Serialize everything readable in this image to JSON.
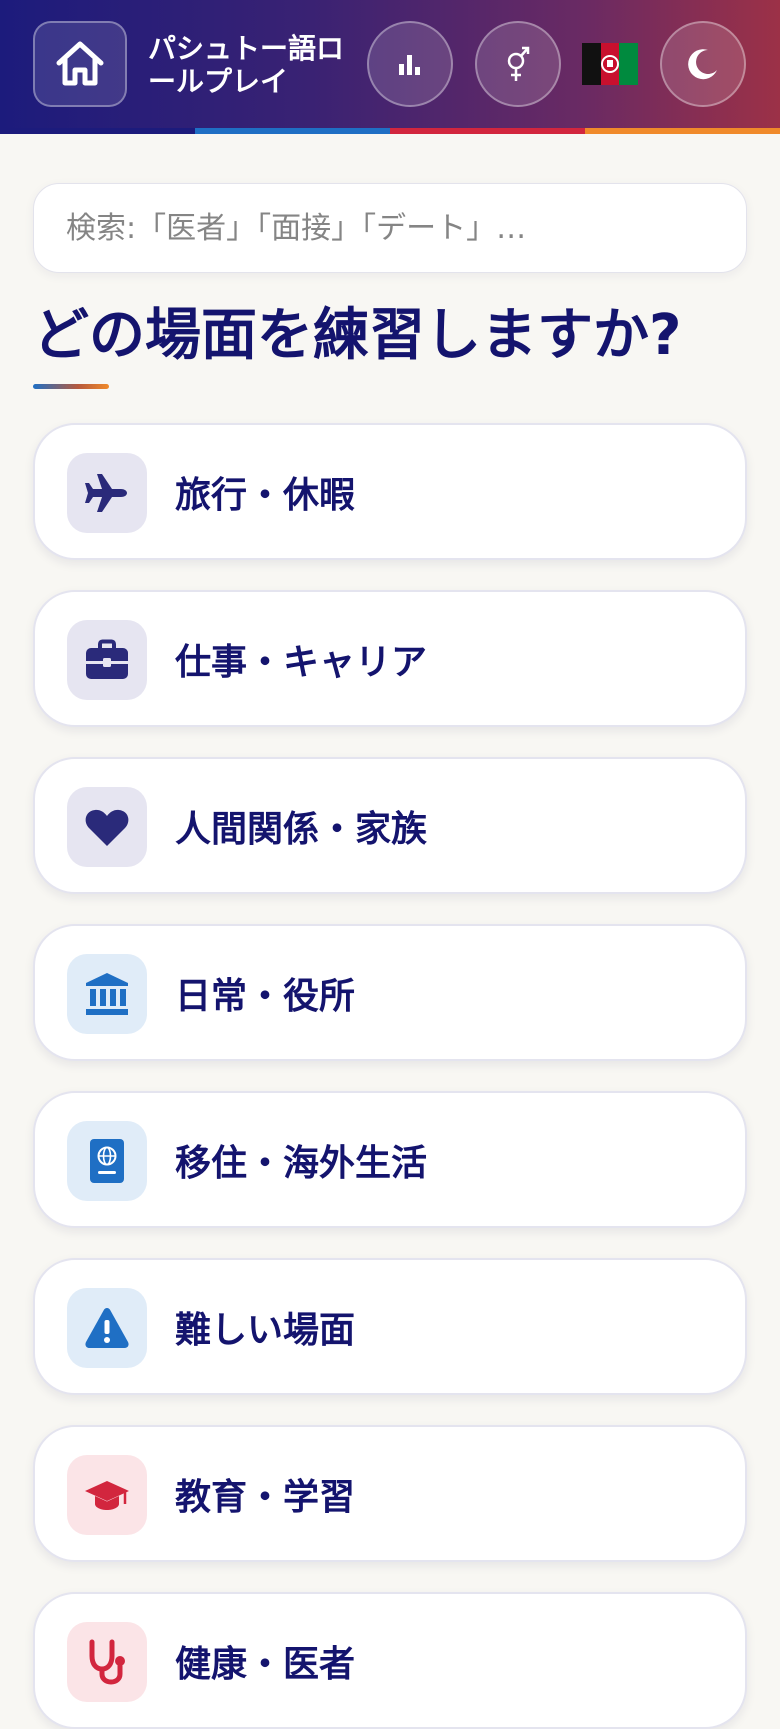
{
  "header": {
    "title": "パシュトー語ロールプレイ",
    "title_line1": "パシュトー語ロ",
    "title_line2": "ールプレイ",
    "stripe_colors": [
      "#1c1b7c",
      "#1f6fc4",
      "#d2263e",
      "#f08a2a"
    ],
    "buttons": {
      "home_icon": "home-icon",
      "stats_icon": "bar-chart-icon",
      "gender_icon": "gender-symbol-icon",
      "flag": "🇦🇫",
      "theme_icon": "moon-icon"
    }
  },
  "search": {
    "placeholder": "検索:「医者」「面接」「デート」…",
    "value": ""
  },
  "heading": "どの場面を練習しますか?",
  "categories": [
    {
      "label": "旅行・休暇",
      "icon": "airplane-icon",
      "color": "#2a2a7a",
      "bg": "#e6e5f1"
    },
    {
      "label": "仕事・キャリア",
      "icon": "briefcase-icon",
      "color": "#2a2a7a",
      "bg": "#e6e5f1"
    },
    {
      "label": "人間関係・家族",
      "icon": "heart-icon",
      "color": "#2a2a7a",
      "bg": "#e6e5f1"
    },
    {
      "label": "日常・役所",
      "icon": "bank-building-icon",
      "color": "#1f6fc4",
      "bg": "#e0ecf8"
    },
    {
      "label": "移住・海外生活",
      "icon": "passport-icon",
      "color": "#1f6fc4",
      "bg": "#e0ecf8"
    },
    {
      "label": "難しい場面",
      "icon": "warning-icon",
      "color": "#1f6fc4",
      "bg": "#e0ecf8"
    },
    {
      "label": "教育・学習",
      "icon": "graduation-cap-icon",
      "color": "#d2263e",
      "bg": "#fbe4e7"
    },
    {
      "label": "健康・医者",
      "icon": "stethoscope-icon",
      "color": "#d2263e",
      "bg": "#fbe4e7"
    }
  ]
}
